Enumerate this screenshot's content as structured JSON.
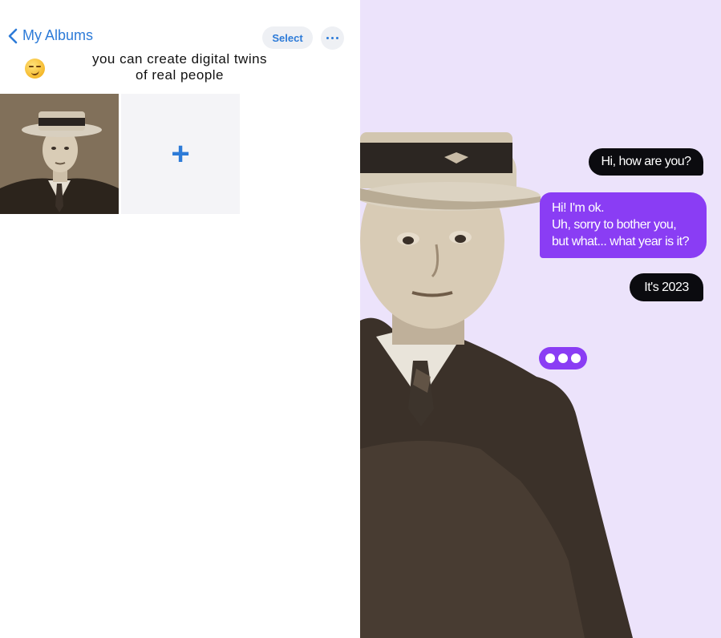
{
  "album": {
    "back_label": "My Albums",
    "select_label": "Select",
    "caption": "you can create digital twins of real people",
    "add_symbol": "+"
  },
  "chat": {
    "messages": [
      {
        "text": "Hi, how are you?"
      },
      {
        "text_lines": [
          "Hi! I'm ok.",
          "Uh, sorry to bother you,",
          "but what... what year is it?"
        ]
      },
      {
        "text": "It's 2023"
      }
    ]
  },
  "colors": {
    "ios_blue": "#2d7bd8",
    "chat_purple": "#8a3df4",
    "chat_dark": "#0b0b0f",
    "right_background": "#ece3fb"
  },
  "icons": [
    "chevron-left-icon",
    "more-icon",
    "smirk-emoji-icon",
    "plus-icon",
    "typing-indicator-icon"
  ]
}
